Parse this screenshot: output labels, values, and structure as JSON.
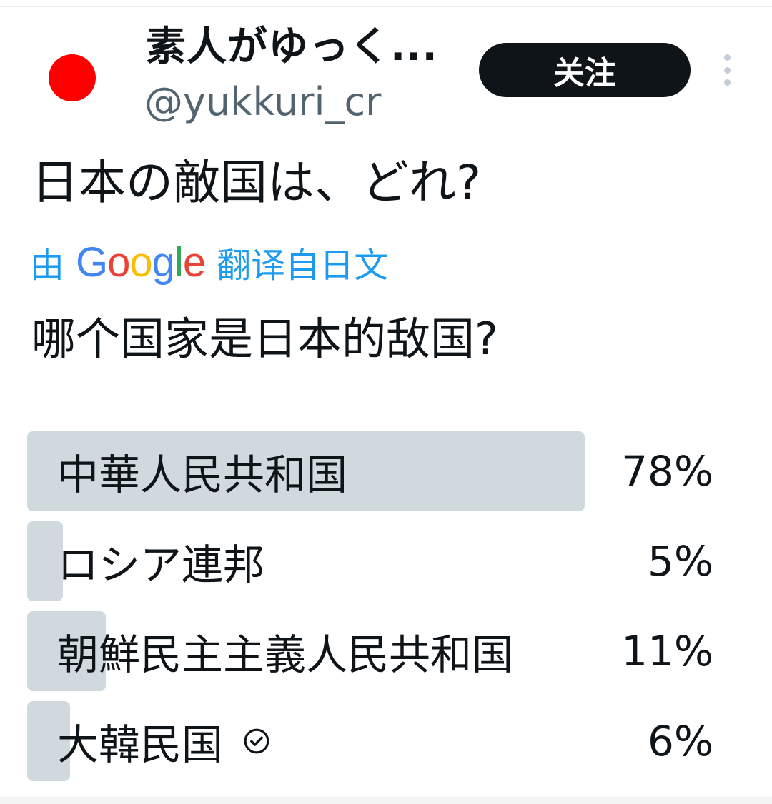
{
  "account": {
    "display_name": "素人がゆっく...",
    "handle": "@yukkuri_cr",
    "avatar_color": "#ff0000",
    "follow_label": "关注"
  },
  "tweet": {
    "text": "日本の敵国は、どれ?",
    "translation": {
      "prefix": "由",
      "provider_letters": [
        "G",
        "o",
        "o",
        "g",
        "l",
        "e"
      ],
      "suffix": "翻译自日文",
      "text": "哪个国家是日本的敌国?"
    }
  },
  "poll": {
    "options": [
      {
        "label": "中華人民共和国",
        "percent_text": "78%",
        "percent": 78,
        "winner": true
      },
      {
        "label": "ロシア連邦",
        "percent_text": "5%",
        "percent": 5,
        "winner": false
      },
      {
        "label": "朝鮮民主主義人民共和国",
        "percent_text": "11%",
        "percent": 11,
        "winner": false
      },
      {
        "label": "大韓民国",
        "percent_text": "6%",
        "percent": 6,
        "winner": false,
        "selected_by_user": true
      }
    ]
  },
  "icons": {
    "more": "more-vertical-icon",
    "check": "check-circle-icon"
  },
  "colors": {
    "poll_fill": "#cfd9de",
    "translate_link": "#1d9bf0",
    "follow_button": "#0f1419"
  }
}
